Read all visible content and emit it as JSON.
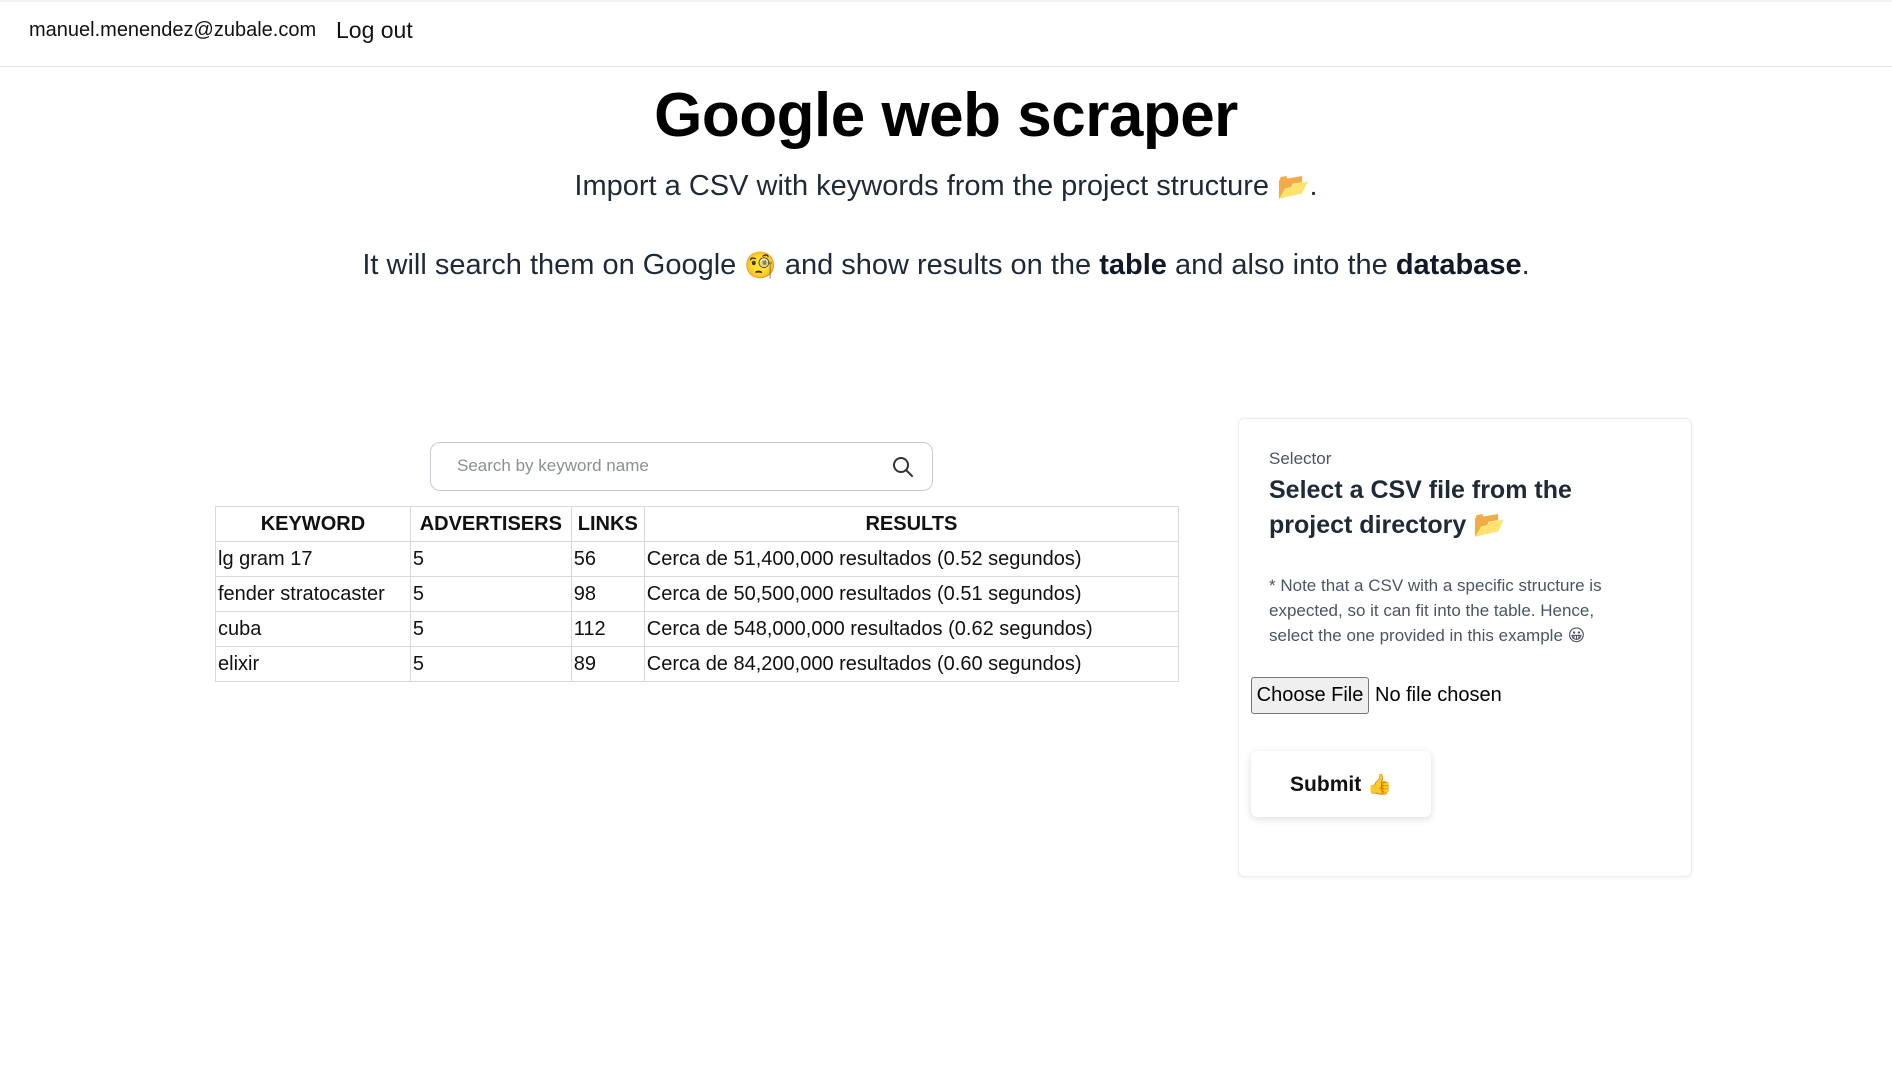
{
  "nav": {
    "user_email": "manuel.menendez@zubale.com",
    "logout_label": "Log out"
  },
  "hero": {
    "title": "Google web scraper",
    "subtitle1_text": "Import a CSV with keywords from the project structure",
    "subtitle1_emoji": "📂",
    "subtitle1_end": ".",
    "subtitle2": {
      "part1": "It will search them on Google",
      "emoji": "🧐",
      "part2": "and show results on the",
      "bold1": "table",
      "part3": "and also into the",
      "bold2": "database",
      "end": "."
    }
  },
  "search": {
    "placeholder": "Search by keyword name",
    "value": "",
    "icon": "search-icon"
  },
  "table": {
    "headers": [
      "KEYWORD",
      "ADVERTISERS",
      "LINKS",
      "RESULTS"
    ],
    "rows": [
      [
        "lg gram 17",
        "5",
        "56",
        "Cerca de 51,400,000 resultados (0.52 segundos)"
      ],
      [
        "fender stratocaster",
        "5",
        "98",
        "Cerca de 50,500,000 resultados (0.51 segundos)"
      ],
      [
        "cuba",
        "5",
        "112",
        "Cerca de 548,000,000 resultados (0.62 segundos)"
      ],
      [
        "elixir",
        "5",
        "89",
        "Cerca de 84,200,000 resultados (0.60 segundos)"
      ]
    ]
  },
  "selector": {
    "label": "Selector",
    "heading": "Select a CSV file from the project directory",
    "heading_emoji": "📂",
    "note": "* Note that a CSV with a specific structure is expected, so it can fit into the table. Hence, select the one provided in this example",
    "note_emoji": "😀",
    "file_button_label": "Choose File",
    "file_status": "No file chosen",
    "submit_label": "Submit",
    "submit_emoji": "👍"
  }
}
